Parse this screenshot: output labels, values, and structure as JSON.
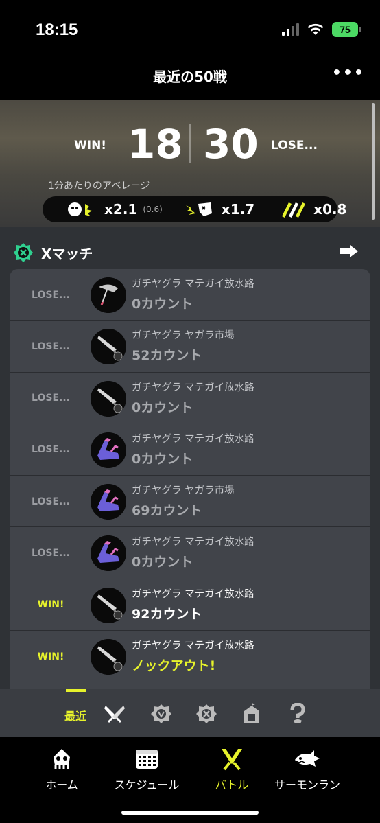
{
  "status": {
    "time": "18:15",
    "battery": "75"
  },
  "header": {
    "title": "最近の50戦",
    "more_icon": "more-icon"
  },
  "summary": {
    "win_label": "WIN!",
    "win_count": "18",
    "lose_count": "30",
    "lose_label": "LOSE...",
    "avg_caption": "1分あたりのアベレージ",
    "kills": "x2.1",
    "kills_assist": "(0.6)",
    "deaths": "x1.7",
    "specials": "x0.8"
  },
  "section": {
    "title": "Xマッチ"
  },
  "battles": [
    {
      "result": "LOSE...",
      "mode": "ガチヤグラ マテガイ放水路",
      "score": "0カウント",
      "weapon": "umbrella"
    },
    {
      "result": "LOSE...",
      "mode": "ガチヤグラ ヤガラ市場",
      "score": "52カウント",
      "weapon": "splatana"
    },
    {
      "result": "LOSE...",
      "mode": "ガチヤグラ マテガイ放水路",
      "score": "0カウント",
      "weapon": "splatana"
    },
    {
      "result": "LOSE...",
      "mode": "ガチヤグラ マテガイ放水路",
      "score": "0カウント",
      "weapon": "purple-blaster"
    },
    {
      "result": "LOSE...",
      "mode": "ガチヤグラ ヤガラ市場",
      "score": "69カウント",
      "weapon": "purple-blaster"
    },
    {
      "result": "LOSE...",
      "mode": "ガチヤグラ マテガイ放水路",
      "score": "0カウント",
      "weapon": "purple-blaster"
    },
    {
      "result": "WIN!",
      "mode": "ガチヤグラ マテガイ放水路",
      "score": "92カウント",
      "weapon": "splatana"
    },
    {
      "result": "WIN!",
      "mode": "ガチヤグラ マテガイ放水路",
      "score": "ノックアウト!",
      "weapon": "splatana"
    }
  ],
  "filter": {
    "recent_label": "最近"
  },
  "tabs": [
    {
      "label": "ホーム",
      "icon": "squid-icon"
    },
    {
      "label": "スケジュール",
      "icon": "calendar-icon"
    },
    {
      "label": "バトル",
      "icon": "battle-icon"
    },
    {
      "label": "サーモンラン",
      "icon": "salmon-icon"
    }
  ],
  "colors": {
    "accent": "#e6f22b",
    "background": "#2f3236",
    "card": "#41444a"
  }
}
